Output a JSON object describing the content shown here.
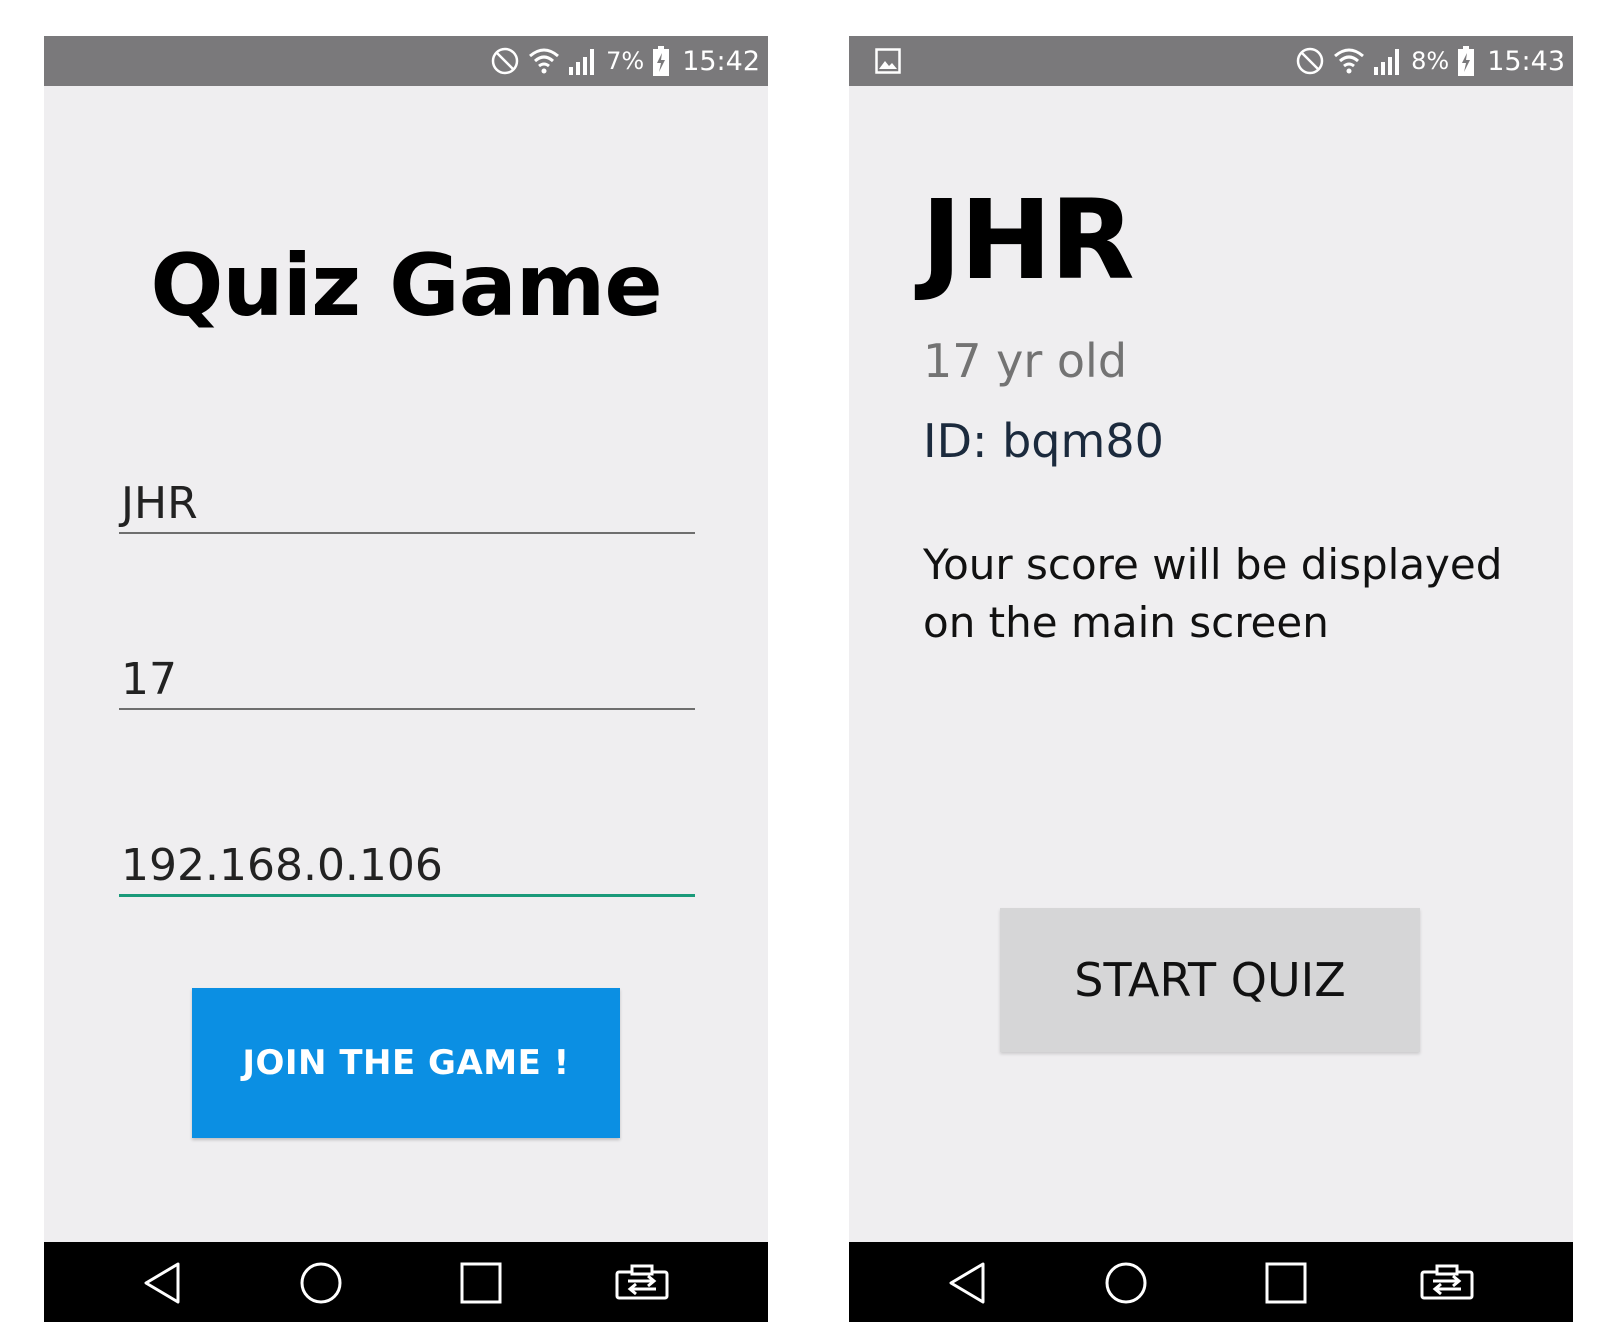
{
  "left_screen": {
    "status_bar": {
      "battery_percent": "7%",
      "time": "15:42",
      "icons": [
        "do-not-disturb-icon",
        "wifi-icon",
        "signal-icon",
        "battery-charging-icon"
      ]
    },
    "title": "Quiz Game",
    "fields": {
      "name_value": "JHR",
      "age_value": "17",
      "ip_value": "192.168.0.106"
    },
    "join_button": "JOIN THE GAME !",
    "colors": {
      "join_button": "#0b8fe3",
      "focus_underline": "#1a9a7a"
    }
  },
  "right_screen": {
    "status_bar": {
      "battery_percent": "8%",
      "time": "15:43",
      "icons": [
        "image-notification-icon",
        "do-not-disturb-icon",
        "wifi-icon",
        "signal-icon",
        "battery-charging-icon"
      ]
    },
    "player_name": "JHR",
    "age_text": "17 yr old",
    "id_text": "ID: bqm80",
    "score_message": "Your score will be displayed on the main screen",
    "start_button": "START QUIZ",
    "colors": {
      "start_button": "#d6d6d7"
    }
  },
  "nav_bar": {
    "icons": [
      "back-icon",
      "home-icon",
      "recents-icon",
      "screen-mirror-icon"
    ]
  }
}
